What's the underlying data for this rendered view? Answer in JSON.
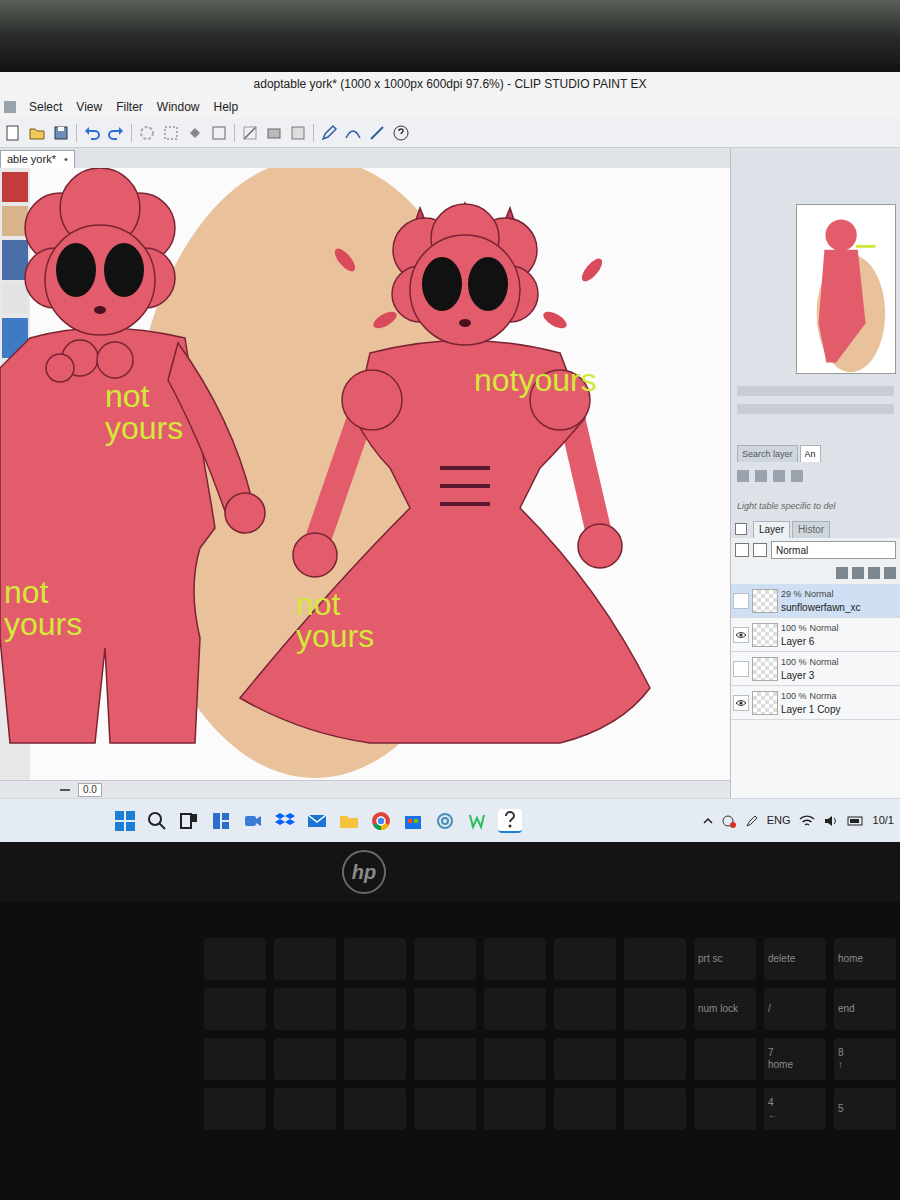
{
  "window": {
    "title": "adoptable york* (1000 x 1000px 600dpi 97.6%) - CLIP STUDIO PAINT EX"
  },
  "menu": [
    "Select",
    "View",
    "Filter",
    "Window",
    "Help"
  ],
  "document_tab": {
    "label": "able york*",
    "close": "•"
  },
  "canvas": {
    "watermarks": [
      "not yours",
      "notyours",
      "not yours",
      "not yours"
    ],
    "zoom_field": "0.0"
  },
  "panel_tabs": [
    {
      "label": "Search layer",
      "selected": false
    },
    {
      "label": "An",
      "selected": true
    }
  ],
  "layers_panel": {
    "note": "Light table specific to del",
    "tabs": [
      {
        "label": "Layer",
        "selected": true
      },
      {
        "label": "Histor",
        "selected": false
      }
    ],
    "blend_mode": "Normal",
    "layers": [
      {
        "opacity": "29 %",
        "mode": "Normal",
        "name": "sunflowerfawn_xc",
        "visible": false,
        "selected": true
      },
      {
        "opacity": "100 %",
        "mode": "Normal",
        "name": "Layer 6",
        "visible": true,
        "selected": false
      },
      {
        "opacity": "100 %",
        "mode": "Normal",
        "name": "Layer 3",
        "visible": false,
        "selected": false
      },
      {
        "opacity": "100 %",
        "mode": "Norma",
        "name": "Layer 1 Copy",
        "visible": true,
        "selected": false
      }
    ]
  },
  "taskbar": {
    "language": "ENG",
    "date": "10/1"
  },
  "laptop": {
    "logo": "hp"
  },
  "keyboard": {
    "rows": [
      [
        {
          "labels": [
            "prt sc"
          ]
        },
        {
          "labels": [
            "delete"
          ]
        },
        {
          "labels": [
            "home"
          ]
        }
      ],
      [
        {
          "labels": [
            "num lock"
          ]
        },
        {
          "labels": [
            "/"
          ]
        },
        {
          "labels": [
            "end"
          ]
        }
      ],
      [
        {
          "labels": [
            "7",
            "home"
          ]
        },
        {
          "labels": [
            "8",
            "↑"
          ]
        }
      ],
      [
        {
          "labels": [
            "4",
            "←"
          ]
        },
        {
          "labels": [
            "5"
          ]
        }
      ]
    ]
  }
}
